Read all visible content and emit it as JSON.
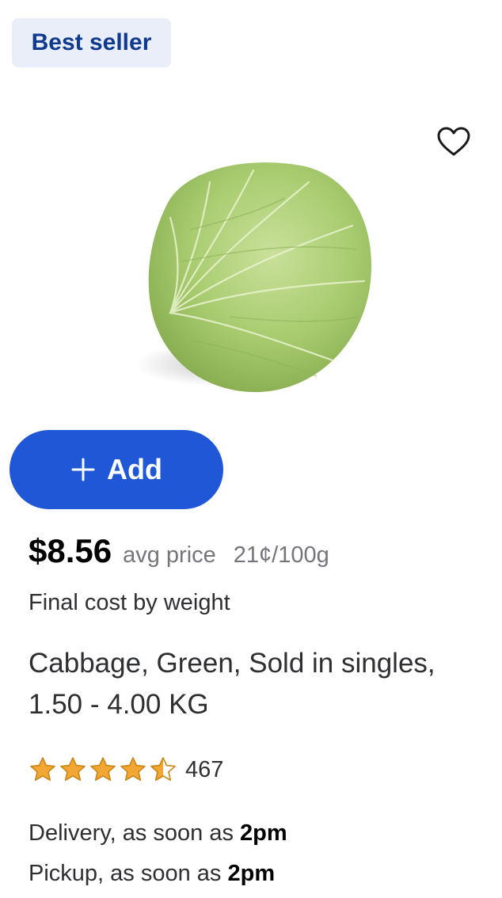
{
  "badge": {
    "label": "Best seller"
  },
  "favorite": {
    "icon": "heart-outline-icon"
  },
  "product": {
    "image_alt": "Cabbage",
    "title": "Cabbage, Green, Sold in singles, 1.50 - 4.00 KG"
  },
  "add_button": {
    "label": "Add",
    "icon": "plus-icon",
    "color": "#1f57d6"
  },
  "pricing": {
    "price": "$8.56",
    "avg_label": "avg price",
    "unit_price": "21¢/100g",
    "final_cost_note": "Final cost by weight"
  },
  "rating": {
    "stars": 4.5,
    "max_stars": 5,
    "count": "467",
    "star_color": "#f2a735"
  },
  "fulfillment": {
    "delivery_prefix": "Delivery, as soon as ",
    "delivery_time": "2pm",
    "pickup_prefix": "Pickup, as soon as ",
    "pickup_time": "2pm"
  }
}
